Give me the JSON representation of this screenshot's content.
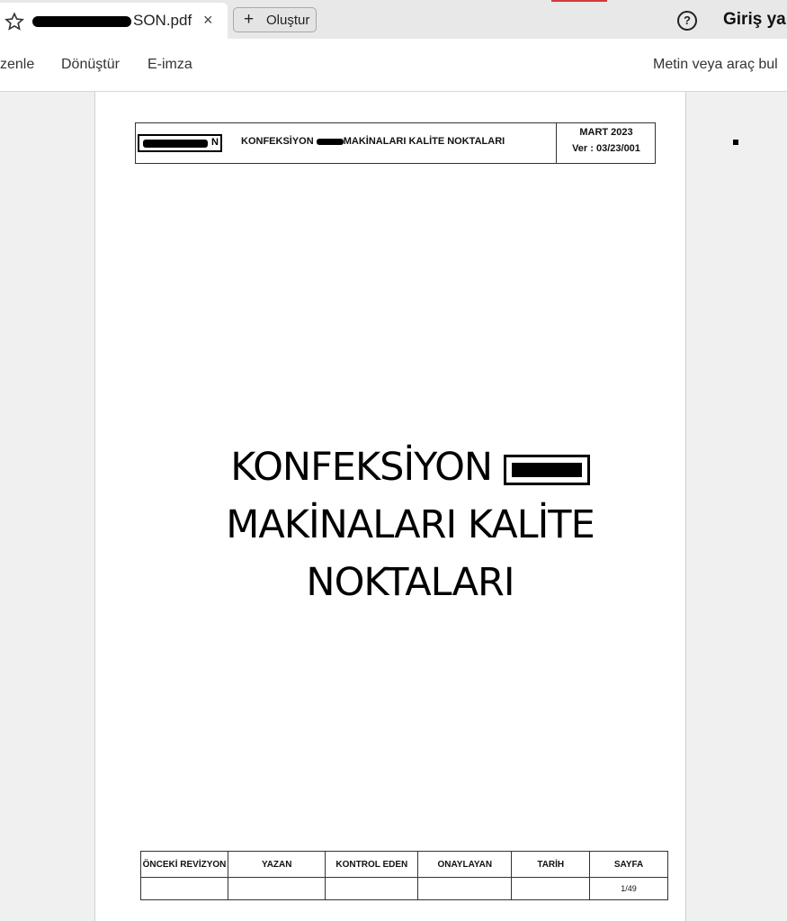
{
  "browser": {
    "tab_title_suffix": "SON.pdf",
    "close_glyph": "×",
    "new_button_label": "Oluştur",
    "new_button_glyph": "+",
    "help_glyph": "?",
    "signin_label": "Giriş ya"
  },
  "toolbar": {
    "items": [
      "zenle",
      "Dönüştür",
      "E-imza"
    ],
    "search_label": "Metin veya araç bul"
  },
  "document": {
    "header": {
      "logo_text": "N",
      "title_before": "KONFEKSİYON",
      "title_after": "MAKİNALARI KALİTE NOKTALARI",
      "date": "MART 2023",
      "version": "Ver : 03/23/001"
    },
    "title": {
      "line1_before": "KONFEKSİYON",
      "line2": "MAKİNALARI KALİTE",
      "line3": "NOKTALARI"
    },
    "footer": {
      "headers": [
        "ÖNCEKİ REVİZYON",
        "YAZAN",
        "KONTROL EDEN",
        "ONAYLAYAN",
        "TARİH",
        "SAYFA"
      ],
      "values": [
        "",
        "",
        "",
        "",
        "",
        "1/49"
      ]
    }
  },
  "colors": {
    "accent": "#d4393b",
    "tab_bar": "#e8e8e8",
    "page_bg": "#ffffff"
  }
}
